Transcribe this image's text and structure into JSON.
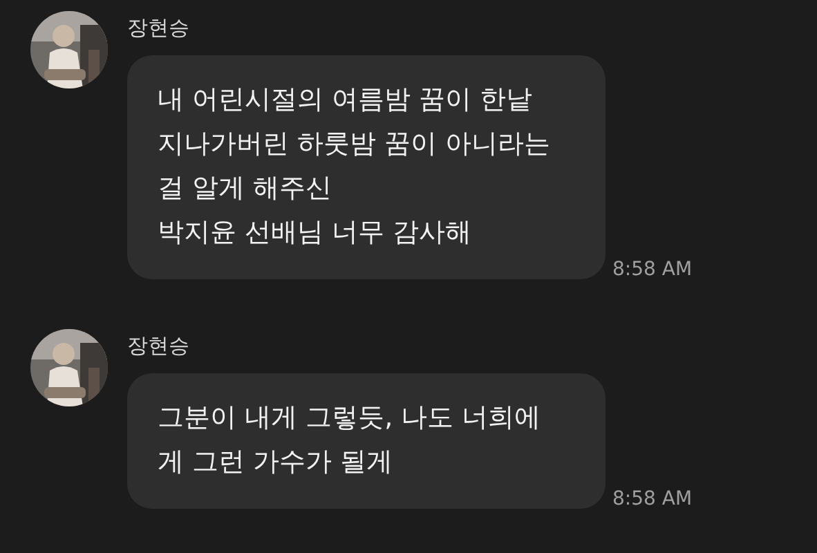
{
  "messages": [
    {
      "sender": "장현승",
      "lines": [
        "내 어린시절의 여름밤 꿈이 한낱",
        "지나가버린 하룻밤 꿈이 아니라는",
        "걸 알게 해주신",
        "박지윤 선배님 너무 감사해"
      ],
      "time": "8:58 AM"
    },
    {
      "sender": "장현승",
      "lines": [
        "그분이 내게 그렇듯, 나도 너희에",
        "게 그런 가수가 될게"
      ],
      "time": "8:58 AM"
    }
  ]
}
